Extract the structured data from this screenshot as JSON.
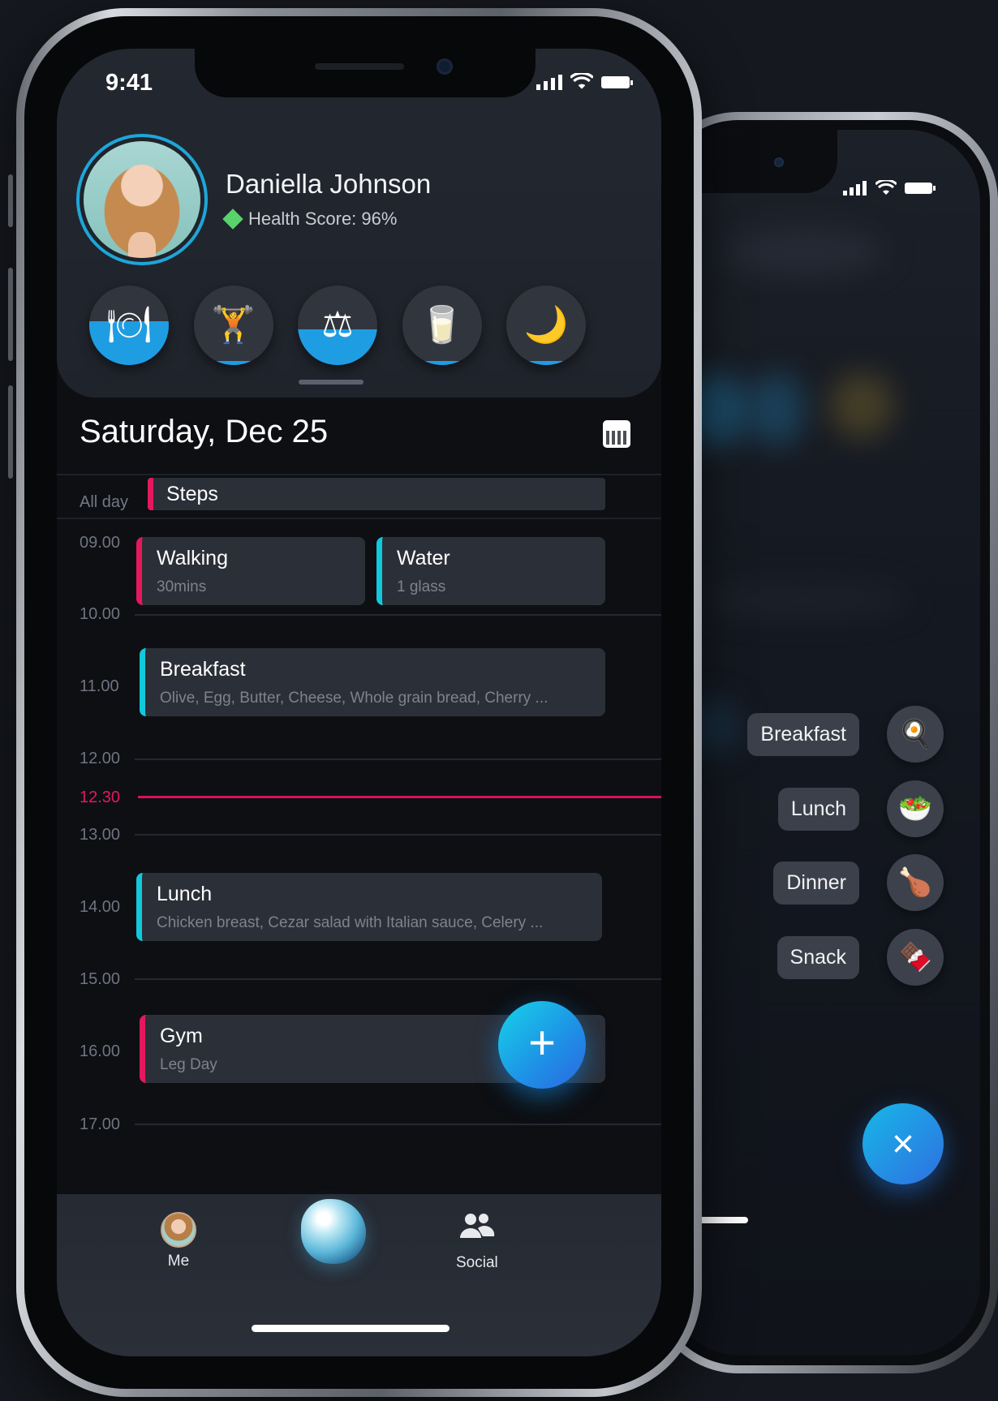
{
  "status": {
    "time": "9:41"
  },
  "profile": {
    "name": "Daniella Johnson",
    "health_score": "Health Score: 96%"
  },
  "categories": [
    {
      "name": "nutrition",
      "icon": "🍽",
      "fill_fraction": 0.55
    },
    {
      "name": "workout",
      "icon": "🏋",
      "fill_fraction": 0.05
    },
    {
      "name": "weight",
      "icon": "⚖",
      "fill_fraction": 0.45
    },
    {
      "name": "water",
      "icon": "🥛",
      "fill_fraction": 0.05
    },
    {
      "name": "sleep",
      "icon": "🌙",
      "fill_fraction": 0.05
    }
  ],
  "date_title": "Saturday, Dec 25",
  "all_day": {
    "label": "All day",
    "event": "Steps"
  },
  "times": {
    "t0900": "09.00",
    "t1000": "10.00",
    "t1100": "11.00",
    "t1200": "12.00",
    "t1230": "12.30",
    "t1300": "13.00",
    "t1400": "14.00",
    "t1500": "15.00",
    "t1600": "16.00",
    "t1700": "17.00"
  },
  "events": {
    "walking": {
      "title": "Walking",
      "subtitle": "30mins"
    },
    "water": {
      "title": "Water",
      "subtitle": "1 glass"
    },
    "breakfast": {
      "title": "Breakfast",
      "subtitle": "Olive, Egg, Butter, Cheese, Whole grain bread, Cherry ..."
    },
    "lunch": {
      "title": "Lunch",
      "subtitle": "Chicken breast, Cezar salad with Italian sauce, Celery ..."
    },
    "gym": {
      "title": "Gym",
      "subtitle": "Leg Day"
    }
  },
  "fab": {
    "label": "+"
  },
  "tabbar": {
    "me": "Me",
    "social": "Social"
  },
  "back_menu": {
    "items": [
      {
        "label": "Breakfast",
        "icon": "🍳"
      },
      {
        "label": "Lunch",
        "icon": "🥗"
      },
      {
        "label": "Dinner",
        "icon": "🍗"
      },
      {
        "label": "Snack",
        "icon": "🍫"
      }
    ],
    "close": "×"
  },
  "colors": {
    "accent_pink": "#e3195c",
    "accent_cyan": "#12c9dc",
    "fab_blue": "#1f8fe6"
  }
}
